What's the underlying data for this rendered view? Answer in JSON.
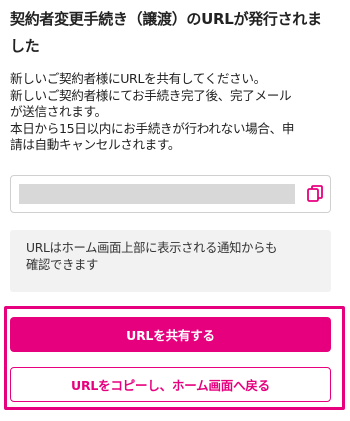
{
  "title_lines": [
    "契約者変更手続き（譲渡）のURLが発行されま",
    "した"
  ],
  "description_lines": [
    "新しいご契約者様にURLを共有してください。",
    " 新しいご契約者様にてお手続き完了後、完了メール",
    "が送信されます。",
    "本日から15日以内にお手続きが行われない場合、申",
    "請は自動キャンセルされます。"
  ],
  "url_field": {
    "icon": "copy-icon"
  },
  "notice_lines": [
    "URLはホーム画面上部に表示される通知からも",
    "確認できます"
  ],
  "buttons": {
    "share": "URLを共有する",
    "copy_home": "URLをコピーし、ホーム画面へ戻る"
  },
  "colors": {
    "accent": "#e6007e",
    "notice_bg": "#f2f2f2"
  }
}
